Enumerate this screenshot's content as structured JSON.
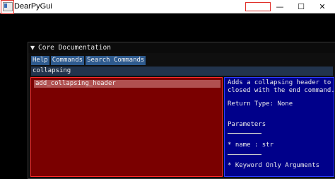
{
  "window": {
    "title": "DearPyGui"
  },
  "controls": {
    "minimize": "—",
    "maximize": "☐",
    "close": "✕"
  },
  "panel": {
    "title": "Core Documentation",
    "collapse_glyph": "▼",
    "menu": [
      "Help",
      "Commands",
      "Search Commands"
    ],
    "search_value": "collapsing",
    "commands": [
      "add_collapsing_header"
    ],
    "doc_lines": [
      "Adds a collapsing header to add",
      "closed with the end command.",
      "",
      "Return Type: None",
      "",
      "Parameters",
      "",
      "* name : str",
      "",
      "* Keyword Only Arguments"
    ]
  },
  "colors": {
    "accent_blue": "#2e5a8e",
    "left_panel": "#7a0000",
    "right_panel": "#00008a",
    "highlight_red": "#e0302a"
  }
}
